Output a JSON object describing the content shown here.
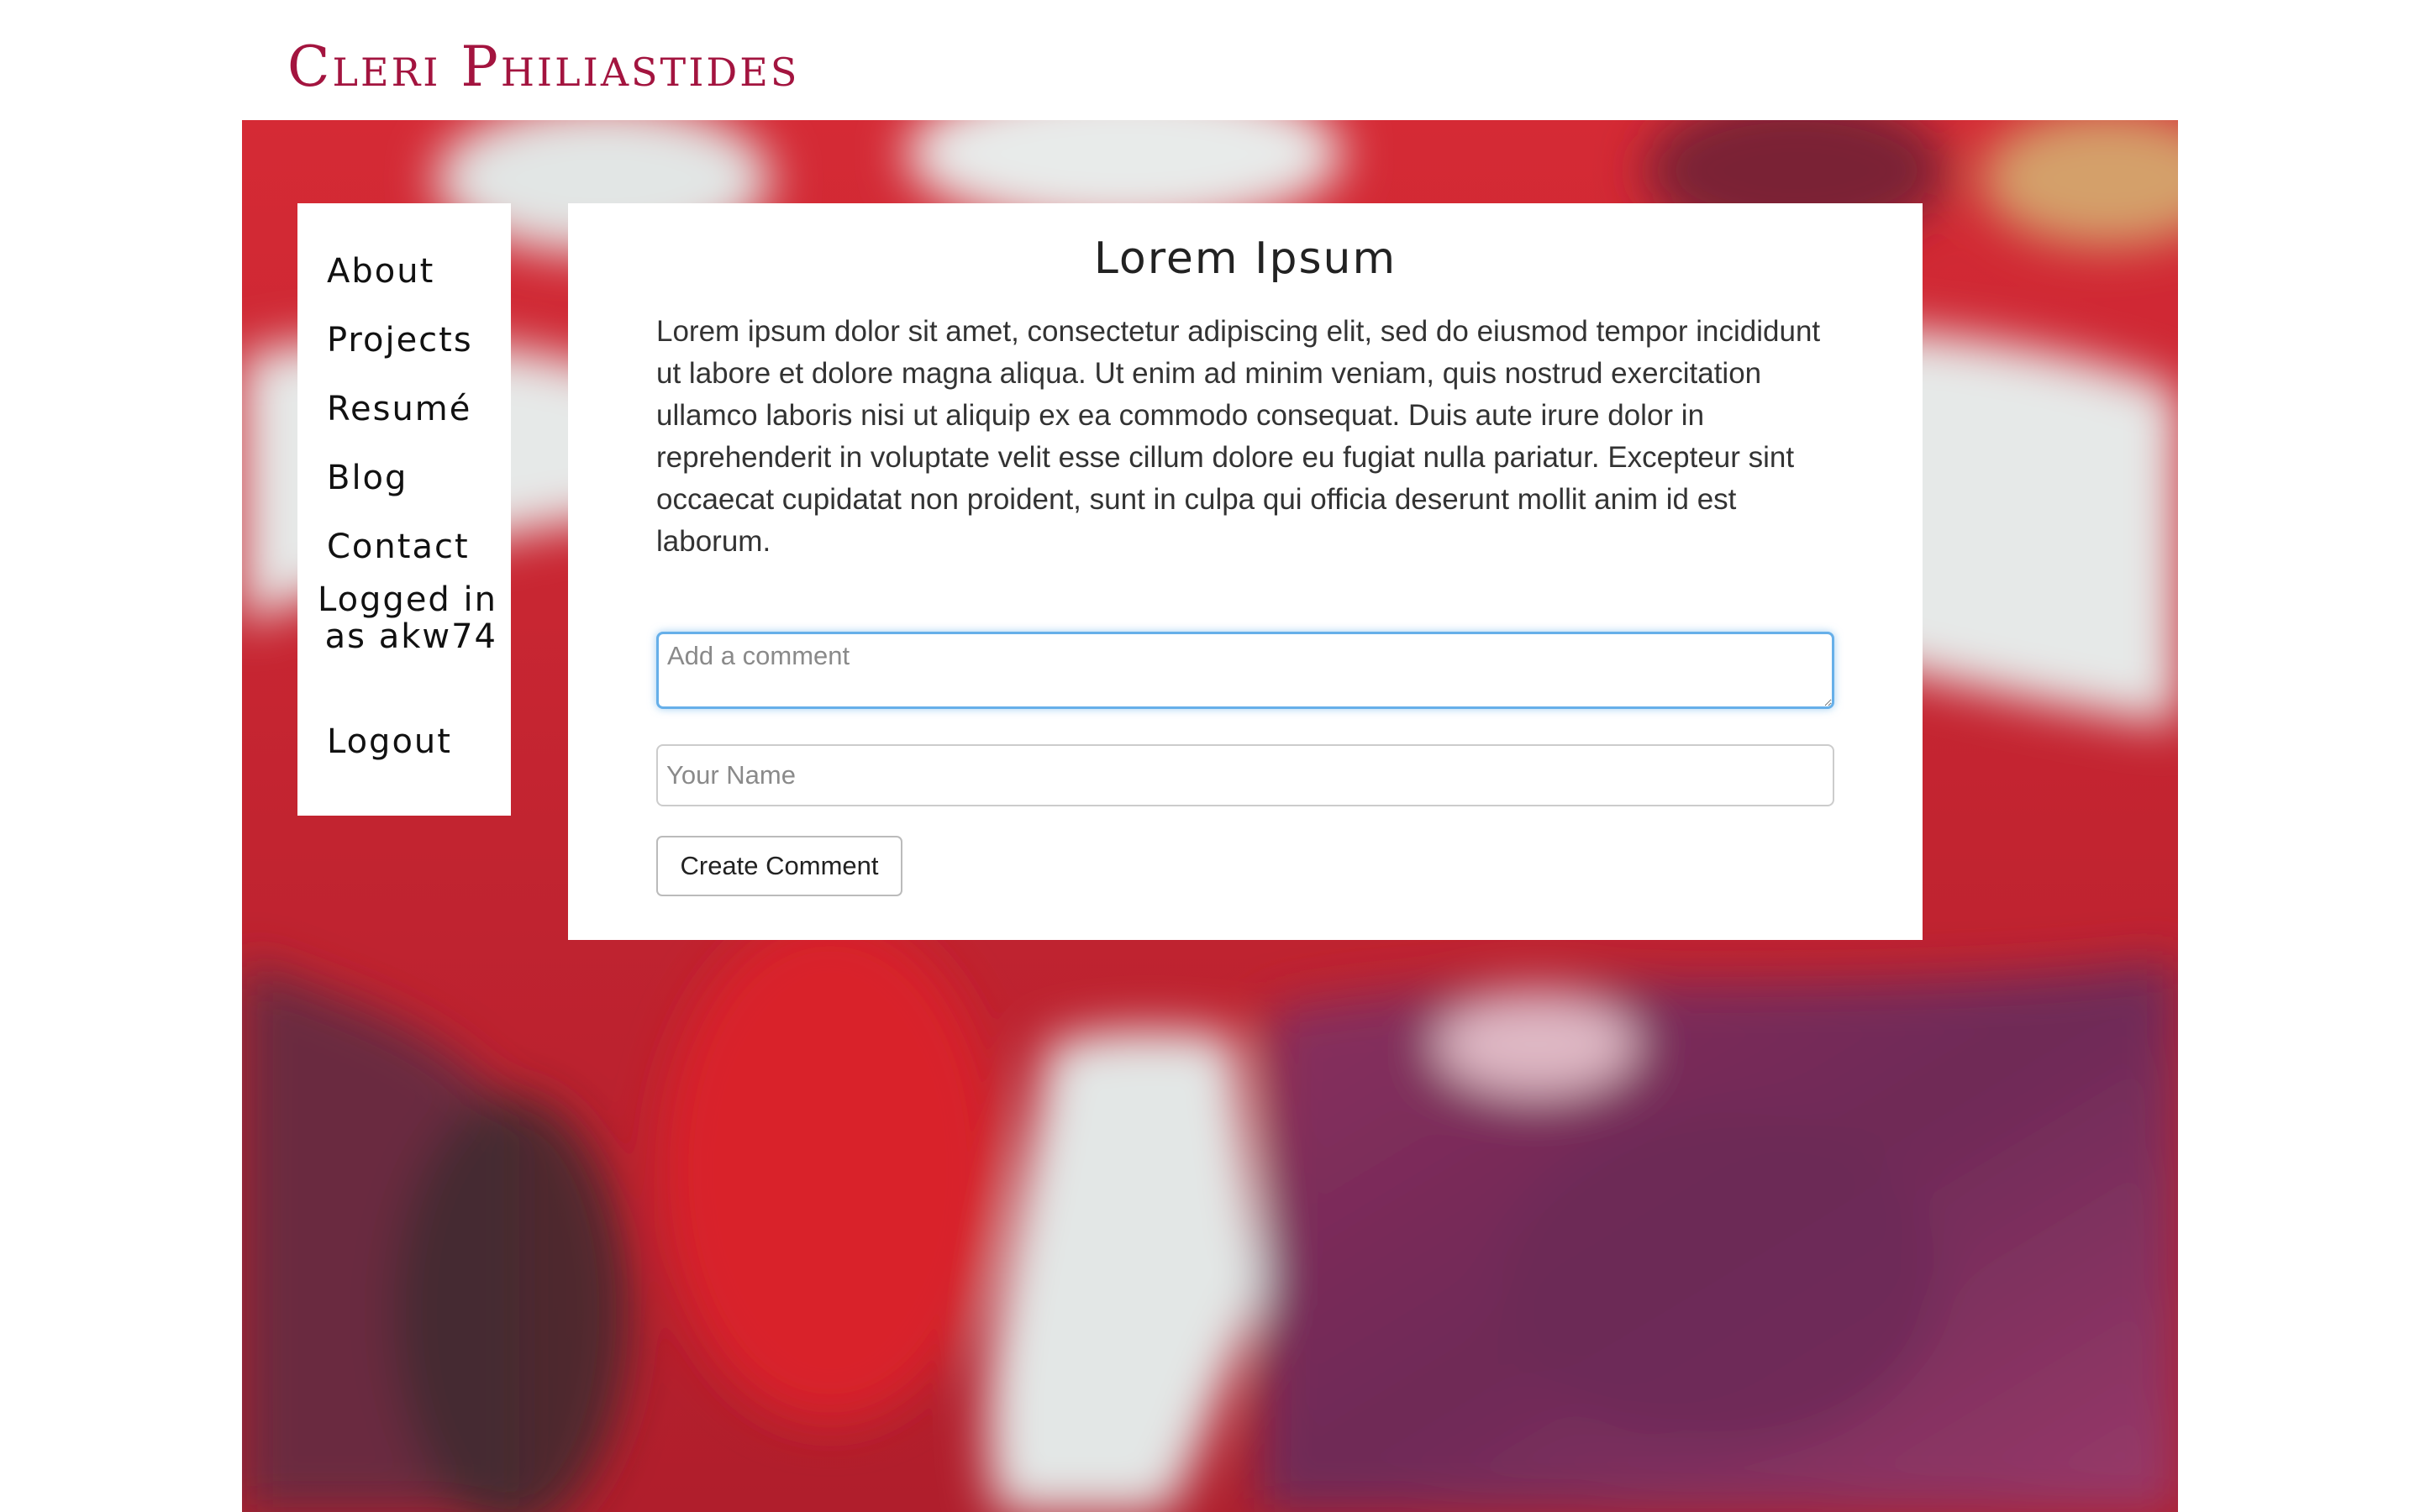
{
  "site": {
    "title": "Cleri Philiastides"
  },
  "nav": {
    "items": [
      {
        "label": "About"
      },
      {
        "label": "Projects"
      },
      {
        "label": "Resumé"
      },
      {
        "label": "Blog"
      },
      {
        "label": "Contact"
      }
    ],
    "logged_in_text": "Logged in as akw74",
    "logout_label": "Logout"
  },
  "post": {
    "title": "Lorem Ipsum",
    "body": "Lorem ipsum dolor sit amet, consectetur adipiscing elit, sed do eiusmod tempor incididunt ut labore et dolore magna aliqua. Ut enim ad minim veniam, quis nostrud exercitation ullamco laboris nisi ut aliquip ex ea commodo consequat. Duis aute irure dolor in reprehenderit in voluptate velit esse cillum dolore eu fugiat nulla pariatur. Excepteur sint occaecat cupidatat non proident, sunt in culpa qui officia deserunt mollit anim id est laborum."
  },
  "comment_form": {
    "comment_placeholder": "Add a comment",
    "comment_value": "",
    "name_placeholder": "Your Name",
    "name_value": "",
    "submit_label": "Create Comment"
  },
  "colors": {
    "brand": "#a3143f",
    "focus_border": "#66afe9",
    "background_red": "#c8323f",
    "background_purple": "#7a2a55",
    "background_white": "#dfe3e2"
  }
}
